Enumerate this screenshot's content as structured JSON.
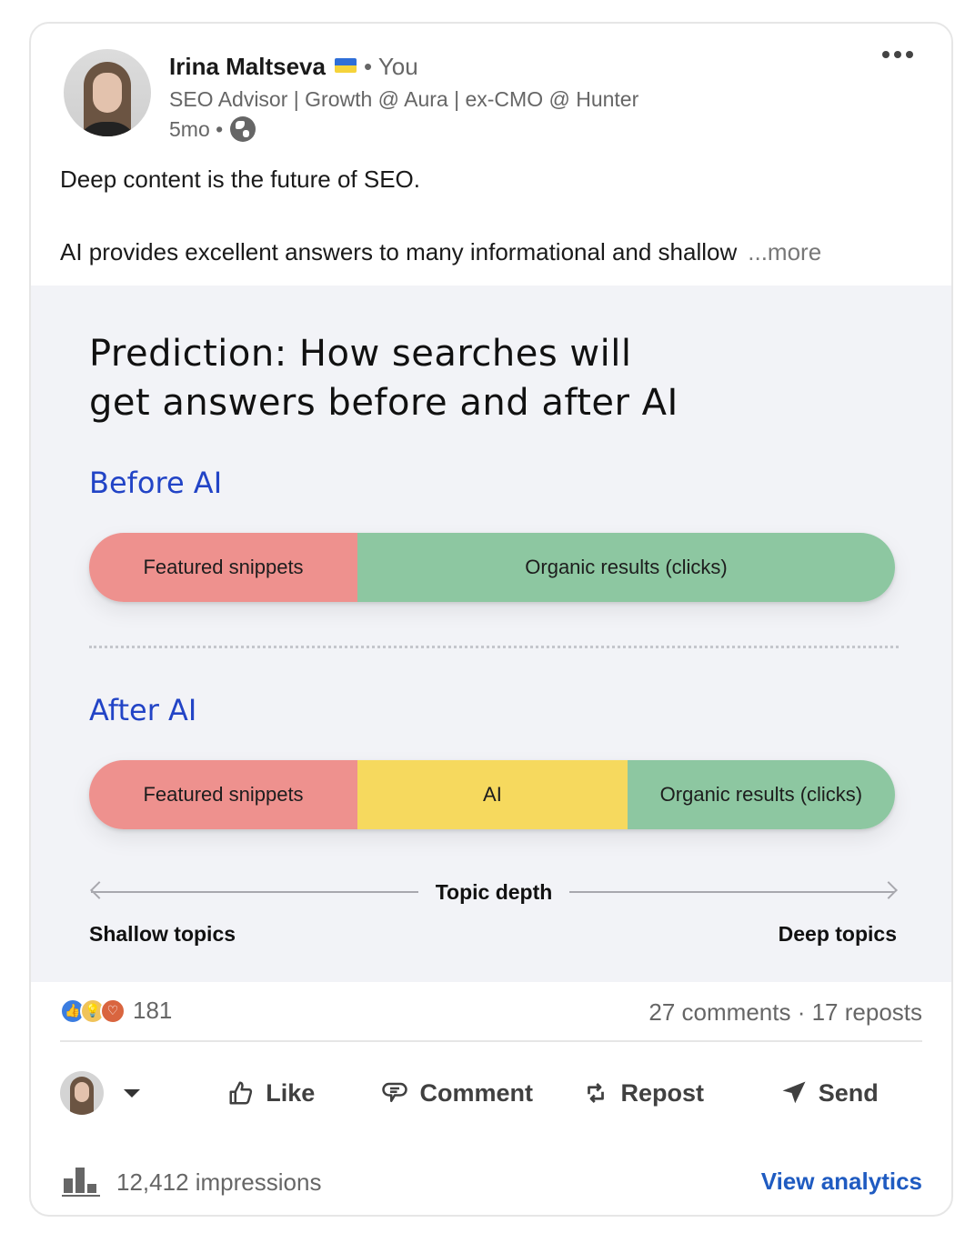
{
  "post": {
    "author": {
      "name": "Irina Maltseva",
      "flag": "ukraine-flag",
      "relation": "• You",
      "headline": "SEO Advisor | Growth @ Aura | ex-CMO @ Hunter",
      "time": "5mo •",
      "visibility_icon": "globe-icon"
    },
    "more_menu_icon": "more-horizontal-icon",
    "text_line1": "Deep content is the future of SEO.",
    "text_line2": "AI provides excellent answers to many informational and shallow",
    "see_more": "...more"
  },
  "figure": {
    "title_line1": "Prediction: How searches will",
    "title_line2": "get answers before and after AI",
    "before_label": "Before AI",
    "after_label": "After AI",
    "colors": {
      "featured": "#ee918e",
      "ai": "#f6d95e",
      "organic": "#8dc7a1",
      "section_label": "#2244c6"
    },
    "before_bar": [
      {
        "label": "Featured snippets",
        "share": 0.333,
        "color_key": "featured"
      },
      {
        "label": "Organic results (clicks)",
        "share": 0.667,
        "color_key": "organic"
      }
    ],
    "after_bar": [
      {
        "label": "Featured snippets",
        "share": 0.333,
        "color_key": "featured"
      },
      {
        "label": "AI",
        "share": 0.335,
        "color_key": "ai"
      },
      {
        "label": "Organic results (clicks)",
        "share": 0.332,
        "color_key": "organic"
      }
    ],
    "axis": {
      "title": "Topic depth",
      "left_label": "Shallow topics",
      "right_label": "Deep topics"
    }
  },
  "social": {
    "reactions": [
      "like-reaction-icon",
      "insightful-reaction-icon",
      "love-reaction-icon"
    ],
    "reaction_count": "181",
    "comments": "27 comments",
    "separator": " · ",
    "reposts": "17 reposts"
  },
  "actions": {
    "like": "Like",
    "comment": "Comment",
    "repost": "Repost",
    "send": "Send"
  },
  "footer": {
    "impressions": "12,412 impressions",
    "view_analytics": "View analytics"
  }
}
